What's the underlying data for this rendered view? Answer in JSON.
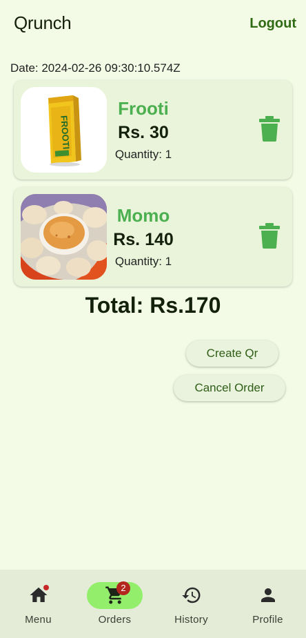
{
  "header": {
    "title": "Qrunch",
    "logout_label": "Logout"
  },
  "order": {
    "date": "Date: 2024-02-26 09:30:10.574Z",
    "items": [
      {
        "name": "Frooti",
        "price": "Rs. 30",
        "quantity": "Quantity: 1"
      },
      {
        "name": "Momo",
        "price": "Rs. 140",
        "quantity": "Quantity: 1"
      }
    ],
    "total": "Total: Rs.170"
  },
  "actions": {
    "create_qr_label": "Create Qr",
    "cancel_order_label": "Cancel Order"
  },
  "nav": {
    "items": [
      {
        "label": "Menu",
        "icon": "home-icon"
      },
      {
        "label": "Orders",
        "icon": "cart-icon",
        "badge": "2",
        "selected": true
      },
      {
        "label": "History",
        "icon": "history-icon"
      },
      {
        "label": "Profile",
        "icon": "person-icon"
      }
    ]
  },
  "colors": {
    "background": "#f3fbe6",
    "accent": "#4caf50",
    "logout": "#2f6b12",
    "selected_pill": "#93ee6c",
    "badge": "#b3261e"
  }
}
